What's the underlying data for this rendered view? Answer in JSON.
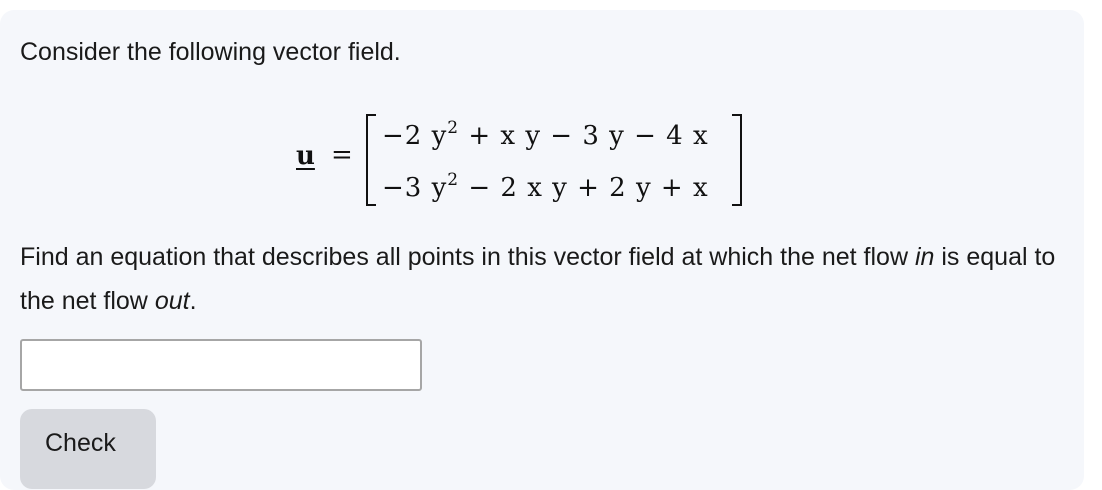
{
  "prompt": "Consider the following vector field.",
  "equation": {
    "vector_label": "u",
    "equals": "=",
    "row1": "−2 y",
    "row1_exp": "2",
    "row1_rest": " + x y − 3 y − 4 x",
    "row2": "−3 y",
    "row2_exp": "2",
    "row2_rest": " − 2 x y + 2 y + x"
  },
  "question": {
    "part1": "Find an equation that describes all points in this vector field at which the net flow ",
    "in_word": "in",
    "part2": " is equal to the net flow ",
    "out_word": "out",
    "part3": "."
  },
  "answer_input": {
    "value": "",
    "placeholder": ""
  },
  "check_button": {
    "label": "Check"
  }
}
